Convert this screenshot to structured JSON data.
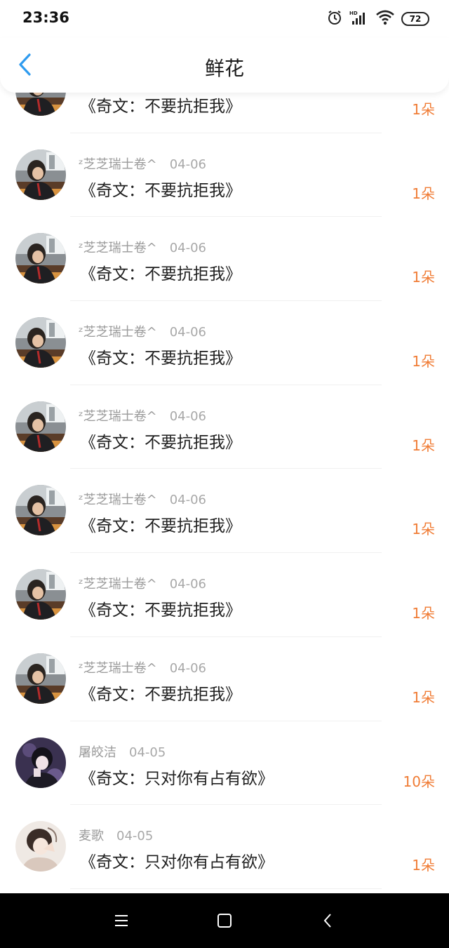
{
  "status": {
    "time": "23:36",
    "battery": "72",
    "icons": [
      "alarm-icon",
      "hd-signal-icon",
      "wifi-icon",
      "battery-icon"
    ]
  },
  "header": {
    "title": "鲜花",
    "back_icon": "chevron-left-icon"
  },
  "colors": {
    "accent": "#2e9bef",
    "count": "#f07c35"
  },
  "rows": [
    {
      "user": "",
      "date": "",
      "title": "《奇文：不要抗拒我》",
      "count": "1朵",
      "avatar": "avatar-a"
    },
    {
      "user": "ᶻ芝芝瑞士卷^",
      "date": "04-06",
      "title": "《奇文：不要抗拒我》",
      "count": "1朵",
      "avatar": "avatar-a"
    },
    {
      "user": "ᶻ芝芝瑞士卷^",
      "date": "04-06",
      "title": "《奇文：不要抗拒我》",
      "count": "1朵",
      "avatar": "avatar-a"
    },
    {
      "user": "ᶻ芝芝瑞士卷^",
      "date": "04-06",
      "title": "《奇文：不要抗拒我》",
      "count": "1朵",
      "avatar": "avatar-a"
    },
    {
      "user": "ᶻ芝芝瑞士卷^",
      "date": "04-06",
      "title": "《奇文：不要抗拒我》",
      "count": "1朵",
      "avatar": "avatar-a"
    },
    {
      "user": "ᶻ芝芝瑞士卷^",
      "date": "04-06",
      "title": "《奇文：不要抗拒我》",
      "count": "1朵",
      "avatar": "avatar-a"
    },
    {
      "user": "ᶻ芝芝瑞士卷^",
      "date": "04-06",
      "title": "《奇文：不要抗拒我》",
      "count": "1朵",
      "avatar": "avatar-a"
    },
    {
      "user": "ᶻ芝芝瑞士卷^",
      "date": "04-06",
      "title": "《奇文：不要抗拒我》",
      "count": "1朵",
      "avatar": "avatar-a"
    },
    {
      "user": "屠皎洁",
      "date": "04-05",
      "title": "《奇文：只对你有占有欲》",
      "count": "10朵",
      "avatar": "avatar-b"
    },
    {
      "user": "麦歌",
      "date": "04-05",
      "title": "《奇文：只对你有占有欲》",
      "count": "1朵",
      "avatar": "avatar-c"
    }
  ],
  "navbar": {
    "items": [
      "menu-icon",
      "home-square-icon",
      "back-triangle-icon"
    ]
  }
}
